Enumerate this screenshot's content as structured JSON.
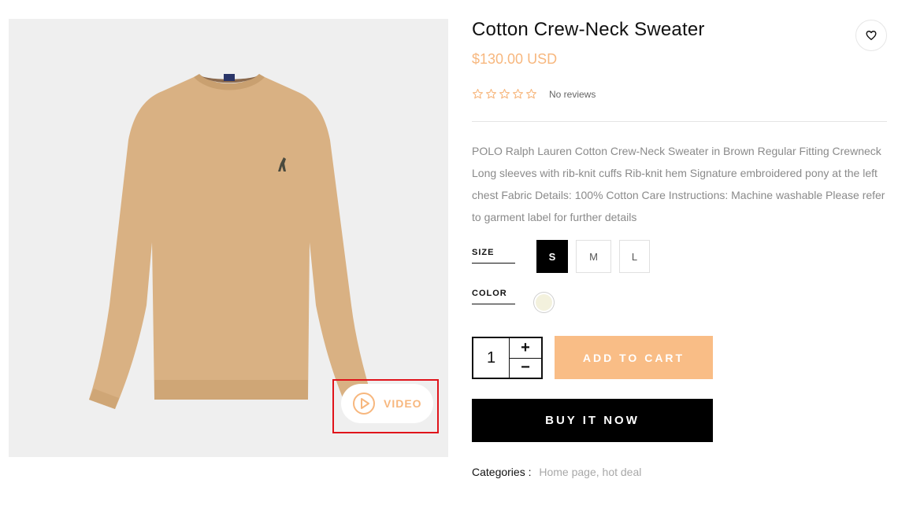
{
  "product": {
    "title": "Cotton Crew-Neck Sweater",
    "price": "$130.00 USD",
    "rating": 0,
    "rating_max": 5,
    "reviews_text": "No reviews",
    "description": "POLO Ralph Lauren Cotton Crew-Neck Sweater in Brown Regular Fitting Crewneck Long sleeves with rib-knit cuffs Rib-knit hem Signature embroidered pony at the left chest Fabric Details: 100% Cotton Care Instructions: Machine washable Please refer to garment label for further details"
  },
  "media": {
    "video_label": "VIDEO",
    "sweater_color": "#d9b183"
  },
  "options": {
    "size_label": "SIZE",
    "sizes": [
      "S",
      "M",
      "L"
    ],
    "selected_size": "S",
    "color_label": "COLOR",
    "colors": [
      "#f3f1dd"
    ]
  },
  "purchase": {
    "quantity": "1",
    "plus": "+",
    "minus": "−",
    "add_to_cart": "ADD TO CART",
    "buy_now": "BUY IT NOW"
  },
  "categories": {
    "label": "Categories :",
    "links": [
      "Home page",
      "hot deal"
    ]
  },
  "colors": {
    "accent": "#f7b77e",
    "button_peach": "#f9bd86",
    "highlight": "#e0141b"
  },
  "icons": {
    "wishlist": "heart-outline-icon",
    "play": "play-circle-icon",
    "star": "star-outline-icon"
  }
}
